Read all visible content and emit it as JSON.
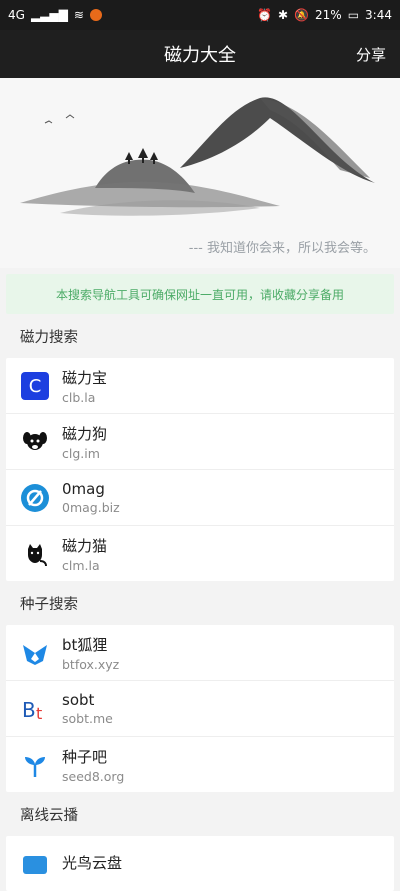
{
  "status": {
    "signal": "4G",
    "battery": "21%",
    "time": "3:44"
  },
  "appbar": {
    "title": "磁力大全",
    "share_label": "分享"
  },
  "hero": {
    "quote": "--- 我知道你会来，所以我会等。"
  },
  "notice": "本搜索导航工具可确保网址一直可用，请收藏分享备用",
  "sections": [
    {
      "title": "磁力搜索",
      "items": [
        {
          "name": "磁力宝",
          "url": "clb.la",
          "icon": "blue-c-icon"
        },
        {
          "name": "磁力狗",
          "url": "clg.im",
          "icon": "dog-icon"
        },
        {
          "name": "0mag",
          "url": "0mag.biz",
          "icon": "null-symbol-icon"
        },
        {
          "name": "磁力猫",
          "url": "clm.la",
          "icon": "cat-icon"
        }
      ]
    },
    {
      "title": "种子搜索",
      "items": [
        {
          "name": "bt狐狸",
          "url": "btfox.xyz",
          "icon": "fox-icon"
        },
        {
          "name": "sobt",
          "url": "sobt.me",
          "icon": "bt-letters-icon"
        },
        {
          "name": "种子吧",
          "url": "seed8.org",
          "icon": "sprout-icon"
        }
      ]
    },
    {
      "title": "离线云播",
      "items": [
        {
          "name": "光鸟云盘",
          "url": "",
          "icon": "blue-box-icon"
        }
      ]
    }
  ],
  "colors": {
    "bar_bg": "#1f1f1f",
    "notice_bg": "#e8f6ea",
    "notice_text": "#4cab67",
    "accent_blue": "#1d3fe0"
  }
}
